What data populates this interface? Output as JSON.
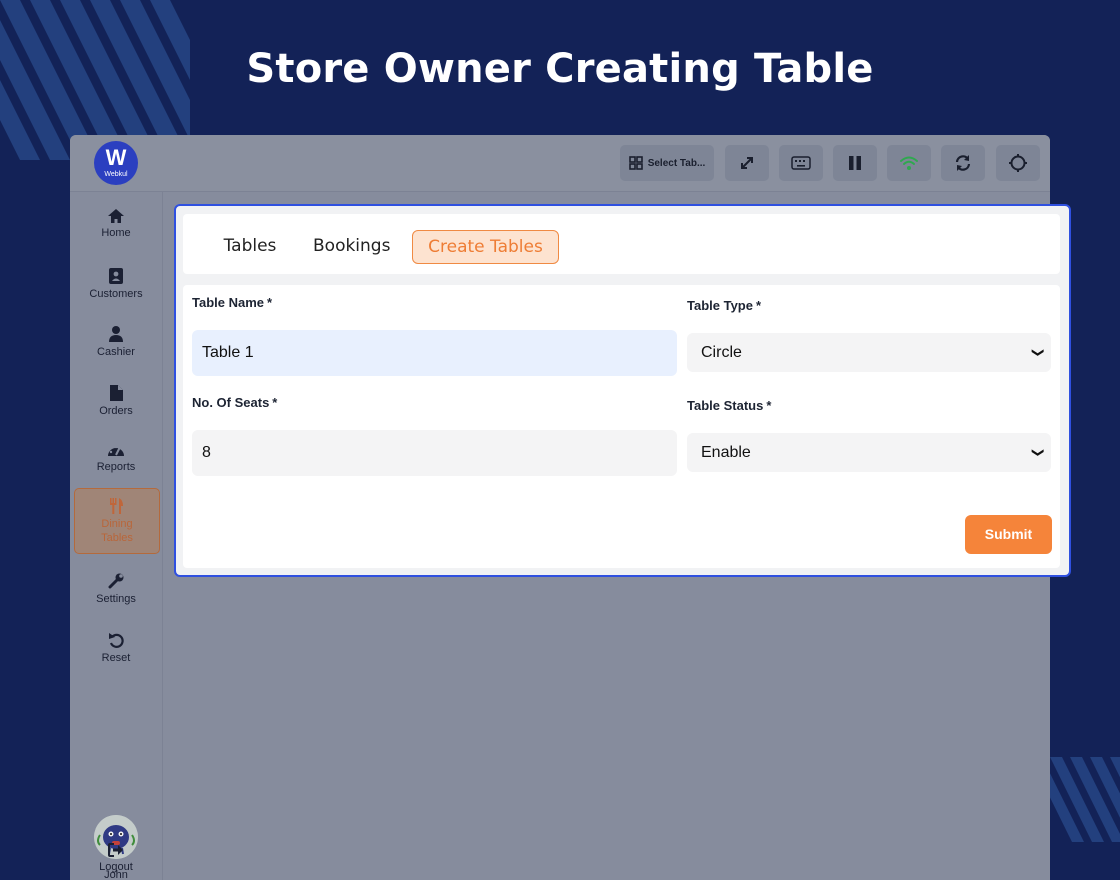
{
  "headline": "Store Owner Creating Table",
  "logo": {
    "mark": "W",
    "brand": "Webkul"
  },
  "toolbar": {
    "select_table": "Select Tab...",
    "icons": [
      "qr-grid-icon",
      "expand-icon",
      "keyboard-icon",
      "pause-icon",
      "wifi-icon",
      "sync-icon",
      "gear-icon"
    ],
    "wifi_color": "#2fa84f"
  },
  "sidebar": {
    "items": [
      {
        "label": "Home",
        "icon": "home-icon"
      },
      {
        "label": "Customers",
        "icon": "contacts-icon"
      },
      {
        "label": "Cashier",
        "icon": "user-icon"
      },
      {
        "label": "Orders",
        "icon": "file-icon"
      },
      {
        "label": "Reports",
        "icon": "dashboard-icon"
      },
      {
        "label_line1": "Dining",
        "label_line2": "Tables",
        "icon": "utensils-icon",
        "active": true
      },
      {
        "label": "Settings",
        "icon": "wrench-icon"
      },
      {
        "label": "Reset",
        "icon": "undo-icon"
      }
    ],
    "user": {
      "name": "John"
    },
    "logout": "Logout"
  },
  "tabs": [
    {
      "label": "Tables"
    },
    {
      "label": "Bookings"
    },
    {
      "label": "Create Tables",
      "active": true
    }
  ],
  "form": {
    "table_name": {
      "label": "Table Name",
      "required": "*",
      "value": "Table 1"
    },
    "table_type": {
      "label": "Table Type",
      "required": "*",
      "value": "Circle"
    },
    "seats": {
      "label": "No. Of Seats",
      "required": "*",
      "value": "8"
    },
    "status": {
      "label": "Table Status",
      "required": "*",
      "value": "Enable"
    },
    "submit_label": "Submit"
  },
  "colors": {
    "accent": "#f5843a",
    "background": "#132257",
    "panel_border": "#2f50e0"
  }
}
